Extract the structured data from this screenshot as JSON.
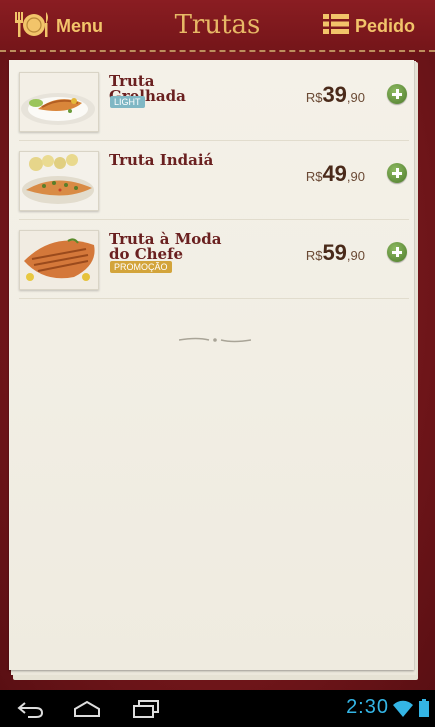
{
  "header": {
    "menu_label": "Menu",
    "title": "Trutas",
    "order_label": "Pedido"
  },
  "items": [
    {
      "name": "Truta Grelhada",
      "badge": "LIGHT",
      "currency": "R$",
      "price_int": "39",
      "price_dec": ",90"
    },
    {
      "name": "Truta Indaiá",
      "badge": "",
      "currency": "R$",
      "price_int": "49",
      "price_dec": ",90"
    },
    {
      "name": "Truta à Moda do Chefe",
      "badge": "PROMOÇÃO",
      "currency": "R$",
      "price_int": "59",
      "price_dec": ",90"
    }
  ],
  "status_bar": {
    "time": "2:30"
  },
  "colors": {
    "header_text": "#f2c46a",
    "title": "#e7b866",
    "item_name": "#6a2020",
    "add_button": "#5a8a34",
    "clock": "#34b5e5",
    "badge_light": "#7fb7c4",
    "badge_promo": "#d3a43a"
  },
  "icons": {
    "menu": "plate-cutlery-icon",
    "order": "list-icon",
    "add": "plus-circle-icon",
    "back": "back-icon",
    "home": "home-icon",
    "recents": "recent-apps-icon",
    "wifi": "wifi-icon",
    "battery": "battery-icon"
  }
}
